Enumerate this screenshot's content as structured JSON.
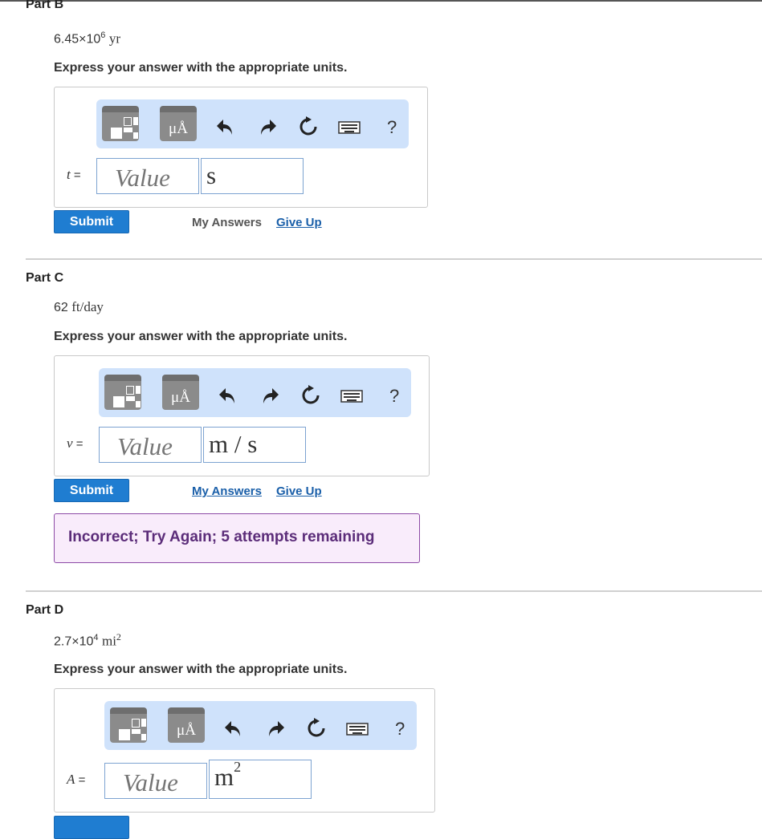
{
  "part_b": {
    "title": "Part B",
    "given_mantissa": "6.45×10",
    "given_exp": "6",
    "given_unit": "yr",
    "instruction": "Express your answer with the appropriate units.",
    "variable": "t",
    "eq": "=",
    "value_placeholder": "Value",
    "unit_value": "s",
    "submit_label": "Submit",
    "my_answers": "My Answers",
    "give_up": "Give Up"
  },
  "part_c": {
    "title": "Part C",
    "given_value": "62",
    "given_unit": "ft/day",
    "instruction": "Express your answer with the appropriate units.",
    "variable": "v",
    "eq": "=",
    "value_placeholder": "Value",
    "unit_value": "m / s",
    "submit_label": "Submit",
    "my_answers": "My Answers",
    "give_up": "Give Up",
    "feedback": "Incorrect; Try Again; 5 attempts remaining"
  },
  "part_d": {
    "title": "Part D",
    "given_mantissa": "2.7×10",
    "given_exp": "4",
    "given_unit": "mi",
    "given_unit_exp": "2",
    "instruction": "Express your answer with the appropriate units.",
    "variable": "A",
    "eq": "=",
    "value_placeholder": "Value",
    "unit_value": "m",
    "unit_exp": "2"
  },
  "toolbar": {
    "units_symbol": "μÅ",
    "help": "?",
    "icons": [
      "templates-icon",
      "units-icon",
      "undo-icon",
      "redo-icon",
      "reset-icon",
      "keyboard-icon",
      "help-icon"
    ]
  },
  "colors": {
    "toolbar_bg": "#cfe2fb",
    "submit_bg": "#1f7dd1",
    "link": "#1a5fa9",
    "feedback_border": "#8d4aa6",
    "feedback_bg": "#f9ecfb"
  }
}
